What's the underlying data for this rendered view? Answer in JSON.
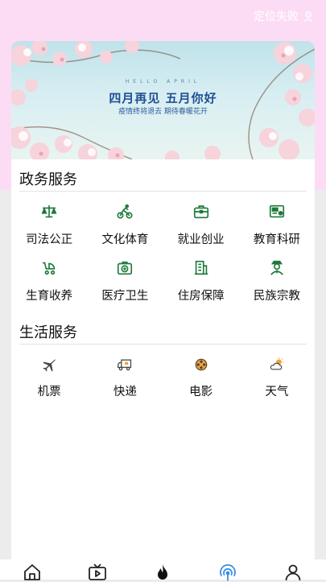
{
  "header": {
    "location_text": "定位失败"
  },
  "banner": {
    "small_text": "HELLO APRIL",
    "title": "四月再见 五月你好",
    "subtitle": "疫情终将退去 期待春暖花开"
  },
  "gov_services": {
    "title": "政务服务",
    "items": [
      {
        "label": "司法公正",
        "icon": "scales-icon"
      },
      {
        "label": "文化体育",
        "icon": "cyclist-icon"
      },
      {
        "label": "就业创业",
        "icon": "briefcase-icon"
      },
      {
        "label": "教育科研",
        "icon": "certificate-icon"
      },
      {
        "label": "生育收养",
        "icon": "stroller-icon"
      },
      {
        "label": "医疗卫生",
        "icon": "medical-kit-icon"
      },
      {
        "label": "住房保障",
        "icon": "building-icon"
      },
      {
        "label": "民族宗教",
        "icon": "person-badge-icon"
      }
    ]
  },
  "life_services": {
    "title": "生活服务",
    "items": [
      {
        "label": "机票",
        "icon": "airplane-icon"
      },
      {
        "label": "快递",
        "icon": "delivery-truck-icon"
      },
      {
        "label": "电影",
        "icon": "film-reel-icon"
      },
      {
        "label": "天气",
        "icon": "weather-icon"
      }
    ]
  },
  "tabbar": {
    "items": [
      {
        "icon": "home-icon"
      },
      {
        "icon": "video-icon"
      },
      {
        "icon": "flame-icon"
      },
      {
        "icon": "signal-icon",
        "active": true
      },
      {
        "icon": "profile-icon"
      }
    ]
  },
  "colors": {
    "gov_icon": "#1d7a3a",
    "life_icon": "#444444",
    "active_tab": "#3a8ee6",
    "header_bg": "#fcdcf4"
  }
}
